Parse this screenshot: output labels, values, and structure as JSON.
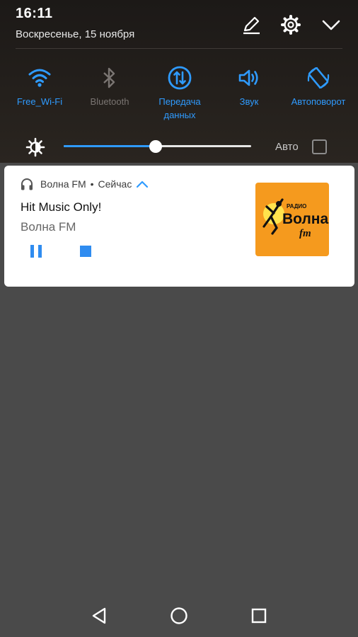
{
  "status": {
    "time": "16:11",
    "date": "Воскресенье, 15 ноября"
  },
  "header_icons": [
    "edit-icon",
    "settings-gear-icon",
    "collapse-chevron-icon"
  ],
  "toggles": [
    {
      "id": "wifi",
      "label": "Free_Wi-Fi",
      "state": "on",
      "icon": "wifi-icon"
    },
    {
      "id": "bluetooth",
      "label": "Bluetooth",
      "state": "off",
      "icon": "bluetooth-icon"
    },
    {
      "id": "data",
      "label": "Передача данных",
      "state": "on",
      "icon": "mobile-data-icon"
    },
    {
      "id": "sound",
      "label": "Звук",
      "state": "on",
      "icon": "speaker-icon"
    },
    {
      "id": "rotate",
      "label": "Автоповорот",
      "state": "on",
      "icon": "auto-rotate-icon"
    }
  ],
  "brightness": {
    "level": 0.49,
    "auto_label": "Авто",
    "auto_checked": false
  },
  "notification": {
    "app": "Волна FM",
    "separator": "•",
    "when": "Сейчас",
    "title": "Hit Music Only!",
    "subtitle": "Волна FM",
    "controls": [
      "pause-icon",
      "stop-icon"
    ],
    "logo": {
      "top_text": "РАДИО",
      "main_text": "Волна",
      "suffix": "fm",
      "bg": "#f59a1e"
    }
  },
  "colors": {
    "accent": "#2f9bff",
    "off": "#7a7572"
  },
  "nav_buttons": [
    "back-icon",
    "home-icon",
    "recents-icon"
  ]
}
